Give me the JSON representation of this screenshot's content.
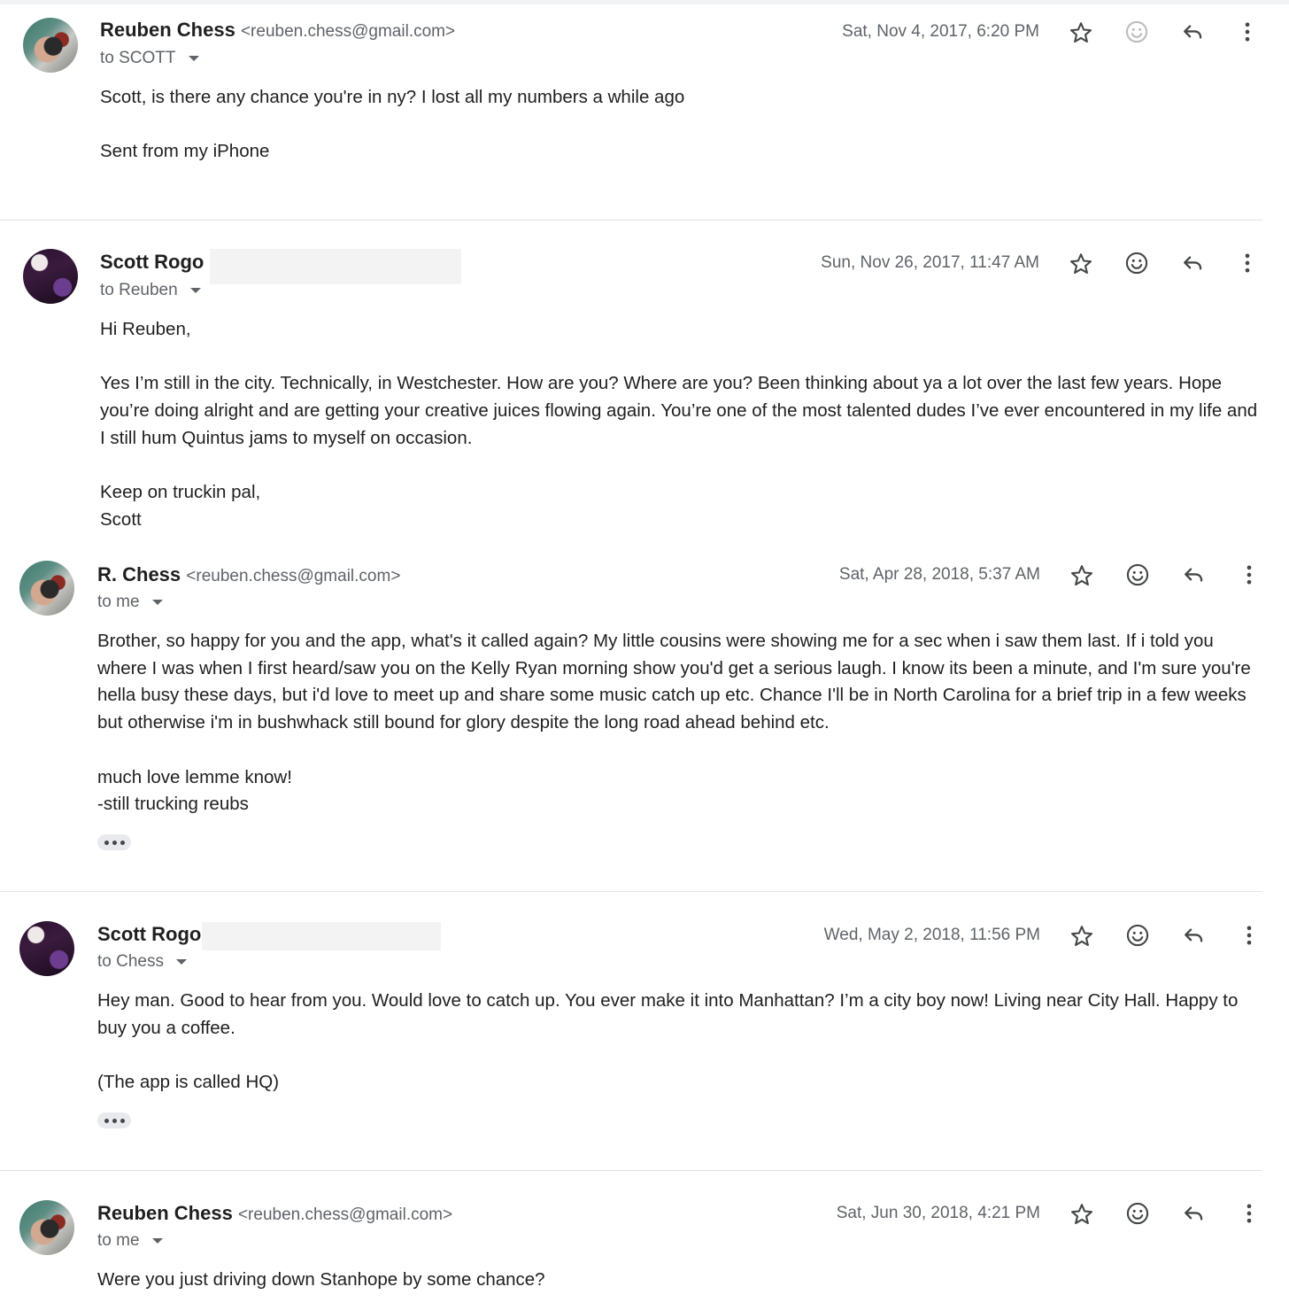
{
  "emails": [
    {
      "sender_name": "Reuben Chess",
      "sender_email": "<reuben.chess@gmail.com>",
      "recipient": "to SCOTT",
      "timestamp": "Sat, Nov 4, 2017, 6:20 PM",
      "body": [
        "Scott, is there any chance you're in ny? I lost all my numbers a while ago",
        "",
        "Sent from my iPhone"
      ],
      "avatar": "reuben-avatar",
      "reaction_icon_state": "disabled"
    },
    {
      "sender_name": "Scott Rogo",
      "sender_email": "",
      "recipient": "to Reuben",
      "timestamp": "Sun, Nov 26, 2017, 11:47 AM",
      "body": [
        "Hi Reuben,",
        "",
        "Yes I’m still in the city. Technically, in Westchester. How are you? Where are you? Been thinking about ya a lot over the last few years. Hope you’re doing alright and are getting your creative juices flowing again. You’re one of the most talented dudes I’ve ever encountered in my life and I still hum Quintus jams to myself on occasion.",
        "",
        "Keep on truckin pal,",
        "Scott"
      ],
      "avatar": "scott-avatar",
      "reaction_icon_state": "enabled"
    },
    {
      "sender_name": "R. Chess",
      "sender_email": "<reuben.chess@gmail.com>",
      "recipient": "to me",
      "timestamp": "Sat, Apr 28, 2018, 5:37 AM",
      "body": [
        "Brother, so happy for you and the app, what's it called again?  My little cousins were showing me for a sec when i saw them last.  If i told you where I was when I first heard/saw you on the Kelly Ryan morning show you'd get a serious laugh.  I know its been a minute, and I'm sure you're hella busy these days, but i'd love to meet up and share some music catch up etc. Chance I'll be in North Carolina for a brief trip in a few weeks but otherwise i'm in bushwhack still bound for glory despite the long road ahead behind etc.",
        "",
        "much love lemme know!",
        "-still trucking reubs"
      ],
      "avatar": "reuben-avatar",
      "reaction_icon_state": "enabled",
      "has_trimmed_content": true
    },
    {
      "sender_name": "Scott Rogo",
      "sender_email": "",
      "recipient": "to Chess",
      "timestamp": "Wed, May 2, 2018, 11:56 PM",
      "body": [
        "Hey man. Good to hear from you. Would love to catch up. You ever make it into Manhattan? I’m a city boy now! Living near City Hall. Happy to buy you a coffee.",
        "",
        "(The app is called  HQ)"
      ],
      "avatar": "scott-avatar",
      "reaction_icon_state": "enabled",
      "has_trimmed_content": true
    },
    {
      "sender_name": "Reuben Chess",
      "sender_email": "<reuben.chess@gmail.com>",
      "recipient": "to me",
      "timestamp": "Sat, Jun 30, 2018, 4:21 PM",
      "body": [
        "Were you just driving down Stanhope by some chance?"
      ],
      "avatar": "reuben-avatar",
      "reaction_icon_state": "enabled"
    }
  ],
  "icons": [
    "star-icon",
    "emoji-reaction-icon",
    "reply-icon",
    "more-options-icon"
  ]
}
